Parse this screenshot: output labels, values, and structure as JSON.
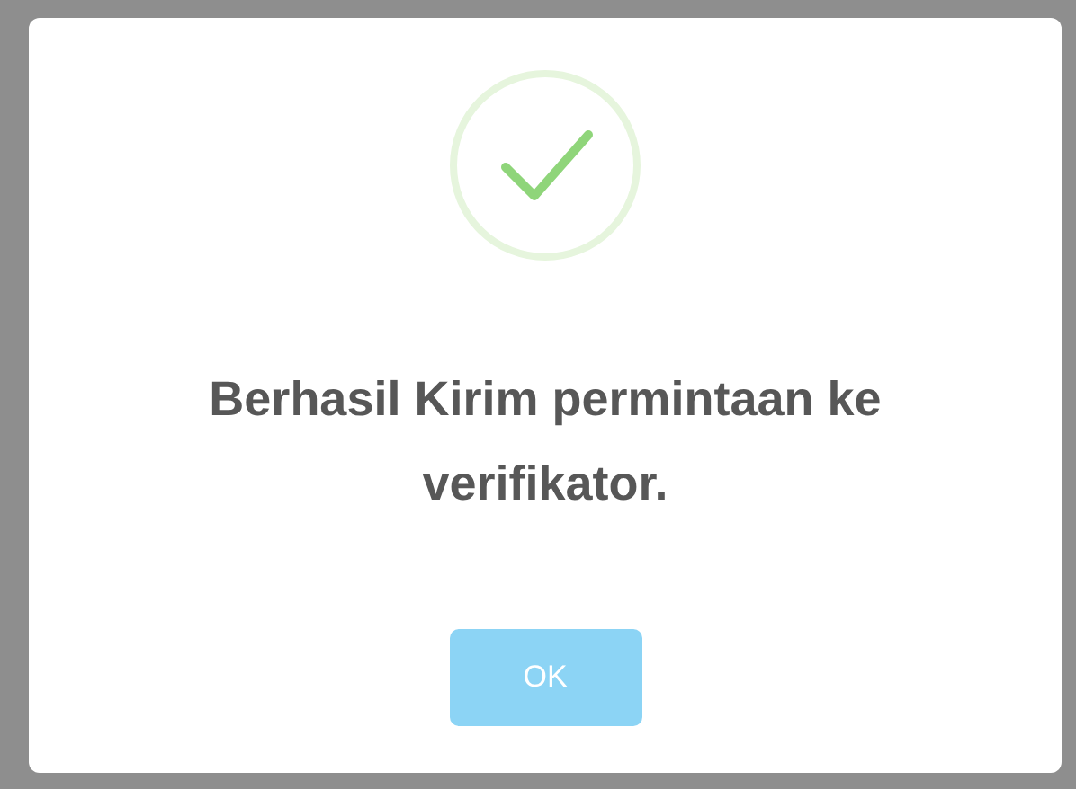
{
  "dialog": {
    "kind": "success",
    "message": "Berhasil Kirim permintaan ke verifikator.",
    "buttons": [
      {
        "label": "OK"
      }
    ]
  }
}
